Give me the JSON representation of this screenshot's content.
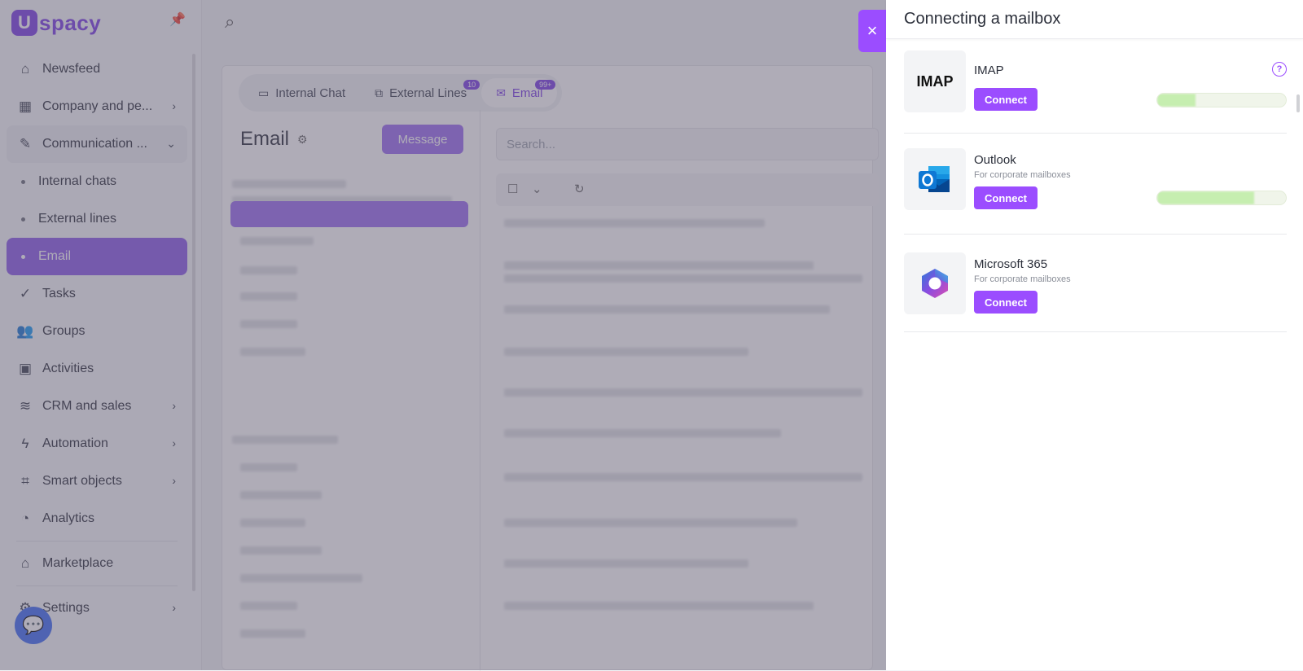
{
  "app": {
    "logo_letter": "U",
    "logo_text": "spacy",
    "nav": [
      {
        "label": "Newsfeed",
        "icon": "home-icon"
      },
      {
        "label": "Company and pe...",
        "icon": "building-icon",
        "chevron": true
      },
      {
        "label": "Communication ...",
        "icon": "chat-edit-icon",
        "chevron": true,
        "expanded": true
      }
    ],
    "nav_sub": [
      {
        "label": "Internal chats"
      },
      {
        "label": "External lines"
      },
      {
        "label": "Email",
        "active": true
      }
    ],
    "nav_rest": [
      {
        "label": "Tasks",
        "icon": "check-circle-icon"
      },
      {
        "label": "Groups",
        "icon": "users-icon"
      },
      {
        "label": "Activities",
        "icon": "calendar-icon"
      },
      {
        "label": "CRM and sales",
        "icon": "database-icon",
        "chevron": true
      },
      {
        "label": "Automation",
        "icon": "bolt-icon",
        "chevron": true
      },
      {
        "label": "Smart objects",
        "icon": "scan-icon",
        "chevron": true
      },
      {
        "label": "Analytics",
        "icon": "chart-icon"
      }
    ],
    "nav_bottom": [
      {
        "label": "Marketplace",
        "icon": "store-icon"
      },
      {
        "label": "Settings",
        "icon": "gear-icon",
        "chevron": true
      }
    ]
  },
  "mail": {
    "tabs": [
      {
        "label": "Internal Chat",
        "badge": ""
      },
      {
        "label": "External Lines",
        "badge": "10"
      },
      {
        "label": "Email",
        "badge": "99+",
        "active": true
      }
    ],
    "title": "Email",
    "message_button": "Message",
    "search_placeholder": "Search..."
  },
  "panel": {
    "title": "Connecting a mailbox",
    "close_glyph": "×",
    "providers": [
      {
        "name": "IMAP",
        "logo_text": "IMAP",
        "description": "",
        "button": "Connect",
        "progress": 0.3
      },
      {
        "name": "Outlook",
        "description": "For corporate mailboxes",
        "button": "Connect",
        "progress": 0.75
      },
      {
        "name": "Microsoft 365",
        "description": "For corporate mailboxes",
        "button": "Connect"
      }
    ]
  },
  "colors": {
    "accent": "#9b4dff",
    "brand": "#7b3fe4",
    "active_nav": "#8a5be8"
  }
}
